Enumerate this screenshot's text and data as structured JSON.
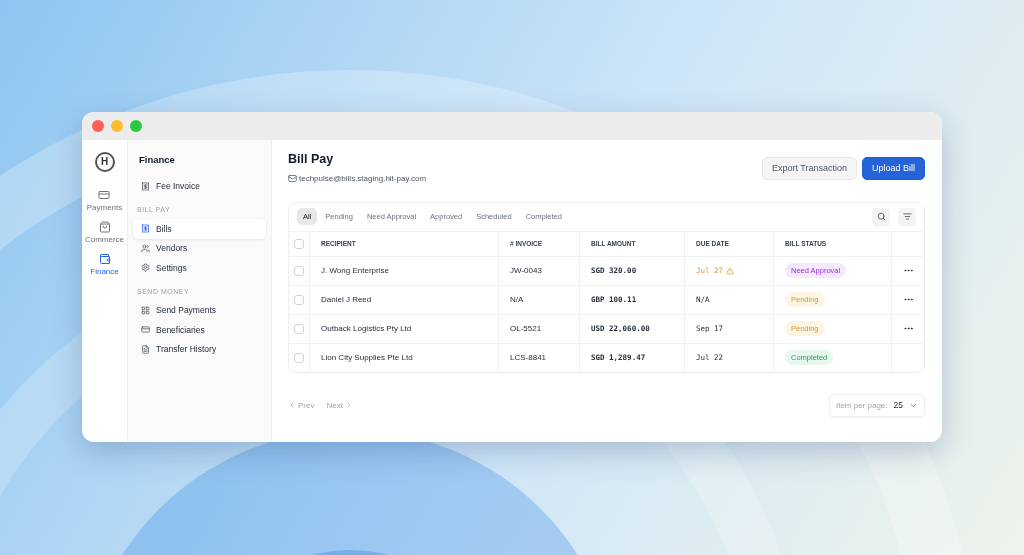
{
  "rail": {
    "logo": "H",
    "items": [
      {
        "label": "Payments",
        "selected": false
      },
      {
        "label": "Commerce",
        "selected": false
      },
      {
        "label": "Finance",
        "selected": true
      }
    ]
  },
  "sidebar": {
    "title": "Finance",
    "sections": [
      {
        "items": [
          {
            "label": "Fee Invoice",
            "selected": false
          }
        ]
      },
      {
        "heading": "BILL PAY",
        "items": [
          {
            "label": "Bills",
            "selected": true
          },
          {
            "label": "Vendors",
            "selected": false
          },
          {
            "label": "Settings",
            "selected": false
          }
        ]
      },
      {
        "heading": "SEND MONEY",
        "items": [
          {
            "label": "Send Payments",
            "selected": false
          },
          {
            "label": "Beneficiaries",
            "selected": false
          },
          {
            "label": "Transfer History",
            "selected": false
          }
        ]
      }
    ]
  },
  "page": {
    "title": "Bill Pay",
    "email": "techpulse@bills.staging.hit-pay.com",
    "buttons": [
      {
        "label": "Export Transaction",
        "kind": "secondary"
      },
      {
        "label": "Upload Bill",
        "kind": "primary"
      }
    ]
  },
  "filters": [
    {
      "label": "All",
      "selected": true
    },
    {
      "label": "Pending",
      "selected": false
    },
    {
      "label": "Need Approval",
      "selected": false
    },
    {
      "label": "Approved",
      "selected": false
    },
    {
      "label": "Scheduled",
      "selected": false
    },
    {
      "label": "Completed",
      "selected": false
    }
  ],
  "table": {
    "all_checked": false,
    "columns": [
      "RECIPIENT",
      "# INVOICE",
      "BILL AMOUNT",
      "DUE DATE",
      "BILL STATUS"
    ],
    "rows": [
      {
        "checked": false,
        "recipient": "J. Wong Enterprise",
        "invoice": "JW-0043",
        "amount": "SGD 320.00",
        "due": "Jul 27",
        "overdue": true,
        "status": {
          "label": "Need Approval",
          "kind": "approval"
        },
        "menu": true
      },
      {
        "checked": false,
        "recipient": "Daniel J Reed",
        "invoice": "N/A",
        "amount": "GBP 100.11",
        "due": "N/A",
        "overdue": false,
        "status": {
          "label": "Pending",
          "kind": "pending"
        },
        "menu": true
      },
      {
        "checked": false,
        "recipient": "Outback Logistics Pty Ltd",
        "invoice": "OL-5521",
        "amount": "USD 22,060.00",
        "due": "Sep 17",
        "overdue": false,
        "status": {
          "label": "Pending",
          "kind": "pending"
        },
        "menu": true
      },
      {
        "checked": false,
        "recipient": "Lion City Supplies Pte Ltd",
        "invoice": "LCS-8841",
        "amount": "SGD 1,289.47",
        "due": "Jul 22",
        "overdue": false,
        "status": {
          "label": "Completed",
          "kind": "completed"
        },
        "menu": false
      }
    ]
  },
  "pagination": {
    "prev": "Prev",
    "next": "Next",
    "per_page_label": "Item per page:",
    "per_page": "25"
  }
}
